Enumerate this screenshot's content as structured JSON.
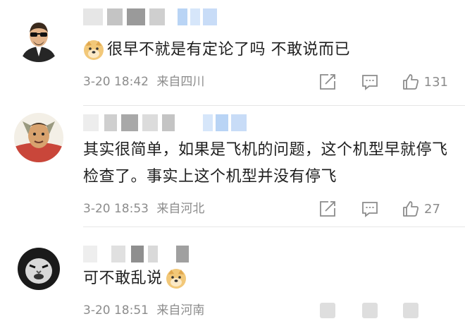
{
  "comments": [
    {
      "text": "很早不就是有定论了吗 不敢说而已",
      "date": "3-20 18:42",
      "location": "来自四川",
      "likes": "131",
      "has_emoji_prefix": true,
      "avatar_icon": "man-sunglasses-avatar-icon"
    },
    {
      "text": "其实很简单，如果是飞机的问题，这个机型早就停飞检查了。事实上这个机型并没有停飞",
      "date": "3-20 18:53",
      "location": "来自河北",
      "likes": "27",
      "avatar_icon": "cartoon-face-avatar-icon"
    },
    {
      "text": "可不敢乱说",
      "date": "3-20 18:51",
      "location": "来自河南",
      "likes": "",
      "has_emoji_suffix": true,
      "avatar_icon": "meme-face-avatar-icon"
    }
  ],
  "colors": {
    "text": "#1f1f1f",
    "meta": "#8c8c8c",
    "divider": "#e6e6e6",
    "blur_blue": "#b9d4f5",
    "blur_gray": "#9a9a9a"
  }
}
